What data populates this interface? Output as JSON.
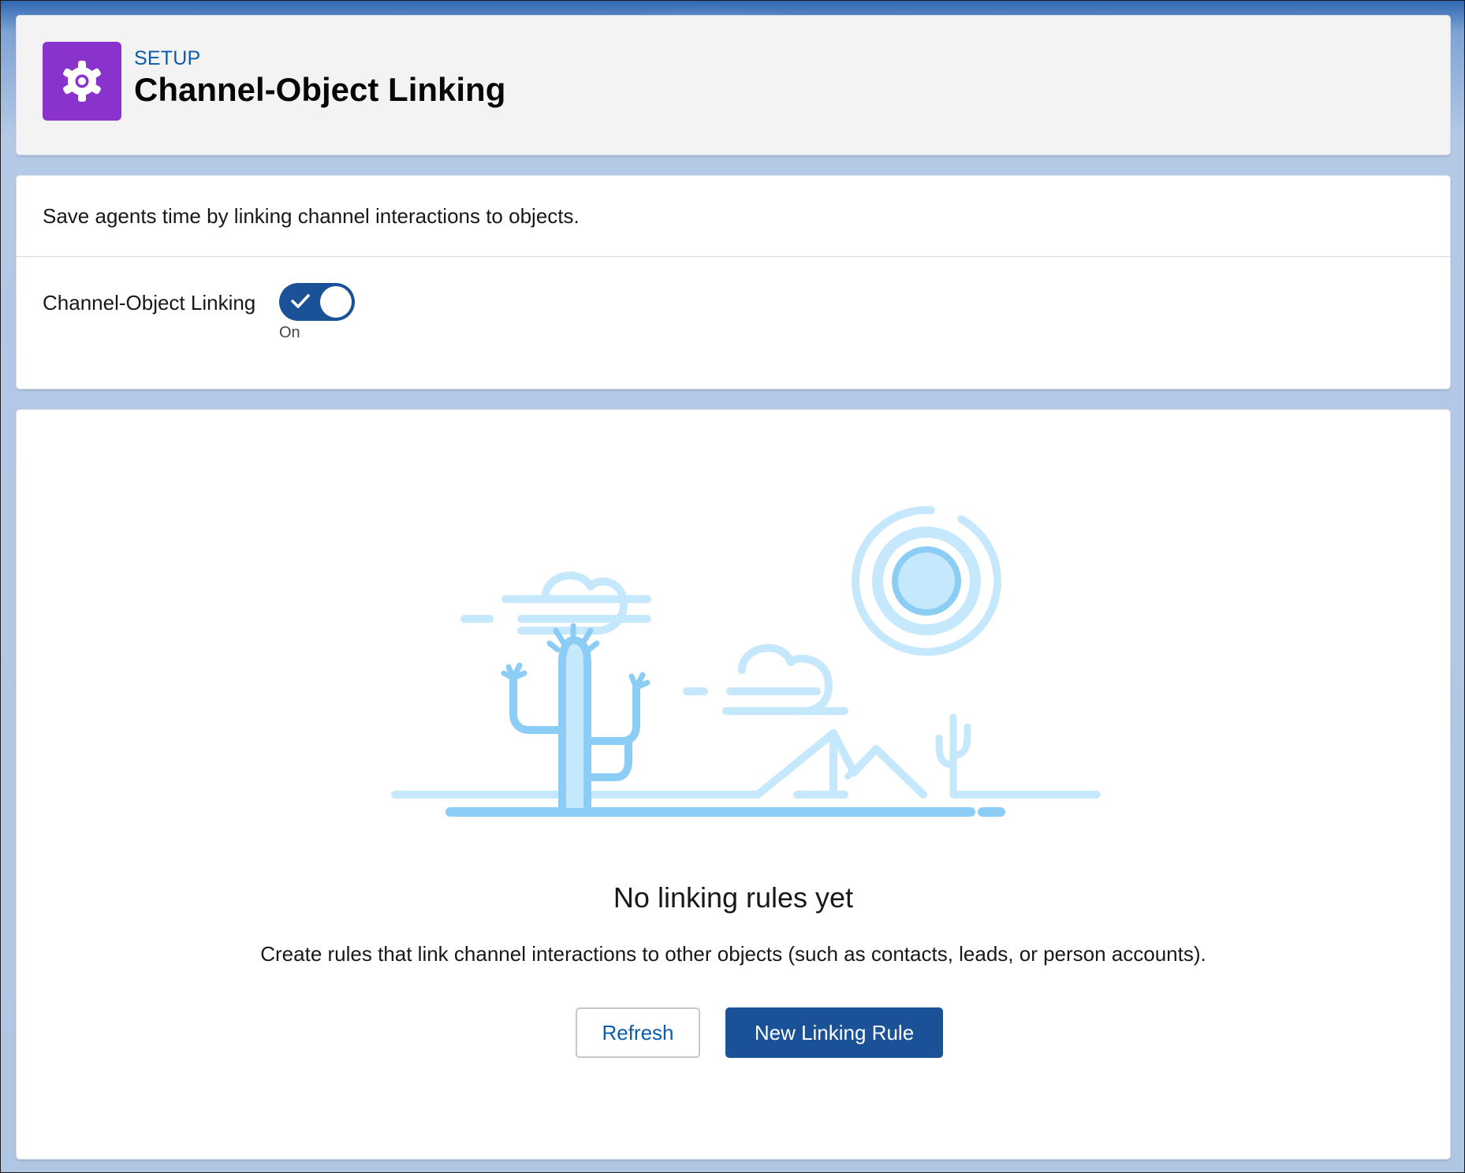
{
  "header": {
    "eyebrow": "SETUP",
    "title": "Channel-Object Linking",
    "icon": "gear-icon"
  },
  "settings": {
    "description": "Save agents time by linking channel interactions to objects.",
    "toggle_label": "Channel-Object Linking",
    "toggle_checked": true,
    "toggle_state_label": "On"
  },
  "empty_state": {
    "illustration": "desert-illustration",
    "title": "No linking rules yet",
    "body": "Create rules that link channel interactions to other objects (such as contacts, leads, or person accounts).",
    "refresh_label": "Refresh",
    "new_rule_label": "New Linking Rule"
  },
  "colors": {
    "brand": "#1b5297",
    "setup_icon": "#8a33cc",
    "link": "#0b5cab",
    "illustration_light": "#c6e8fd",
    "illustration_mid": "#a3d8f9",
    "illustration_dark": "#8ccdf5"
  }
}
